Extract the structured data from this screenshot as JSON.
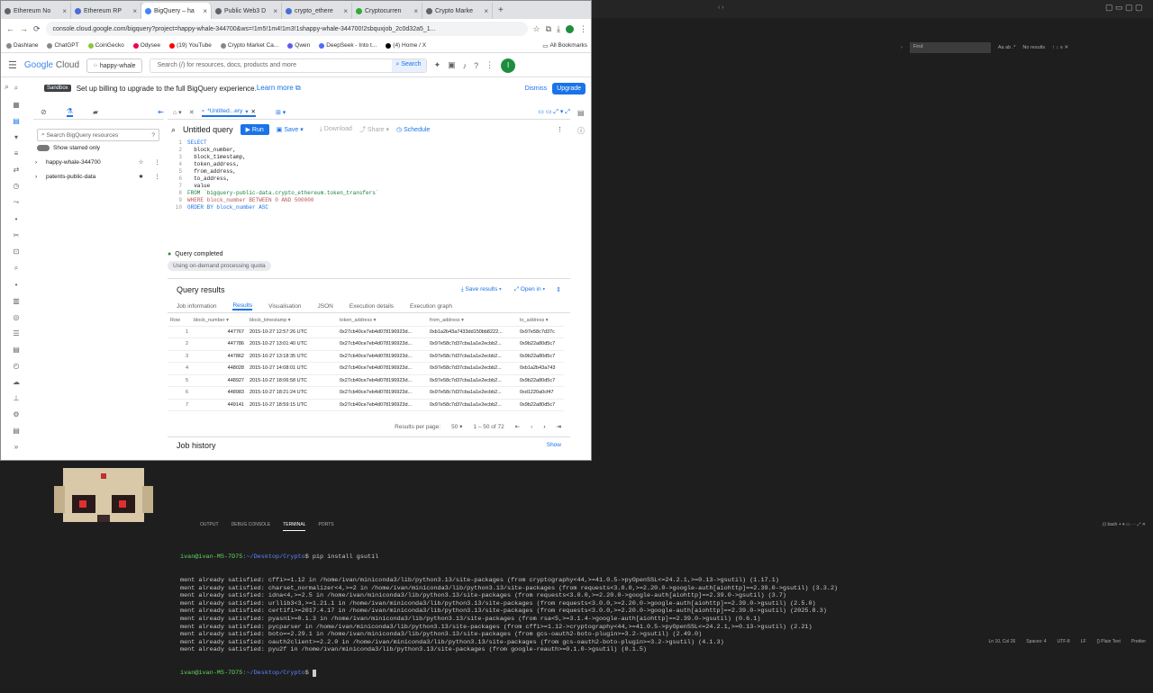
{
  "browser": {
    "tabs": [
      {
        "label": "Ethereum No"
      },
      {
        "label": "Ethereum RP"
      },
      {
        "label": "BigQuery – ha"
      },
      {
        "label": "Public Web3 D"
      },
      {
        "label": "crypto_ethere"
      },
      {
        "label": "Cryptocurren"
      },
      {
        "label": "Crypto Marke"
      }
    ],
    "url": "console.cloud.google.com/bigquery?project=happy-whale-344700&ws=!1m5!1m4!1m3!1shappy-whale-344700!2sbquxjob_2c0d32a5_1...",
    "bookmarks": [
      "Dashlane",
      "ChatGPT",
      "CoinGecko",
      "Odysee",
      "(19) YouTube",
      "Crypto Market Ca...",
      "Qwen",
      "DeepSeek - Into t...",
      "(4) Home / X"
    ],
    "all_bookmarks": "All Bookmarks"
  },
  "gc": {
    "logo_google": "Google",
    "logo_cloud": "Cloud",
    "project": "happy-whale",
    "search_placeholder": "Search (/) for resources, docs, products and more",
    "search_button": "Search",
    "avatar": "I"
  },
  "sandbox": {
    "badge": "Sandbox",
    "text": "Set up billing to upgrade to the full BigQuery experience.",
    "learn_more": "Learn more",
    "dismiss": "Dismiss",
    "upgrade": "Upgrade"
  },
  "explorer": {
    "search_placeholder": "Search BigQuery resources",
    "show_starred": "Show starred only",
    "items": [
      {
        "label": "happy-whale-344700"
      },
      {
        "label": "patents-public-data"
      }
    ]
  },
  "editor": {
    "tab_label": "*Untitled...ery",
    "title": "Untitled query",
    "run": "Run",
    "save": "Save",
    "download": "Download",
    "share": "Share",
    "schedule": "Schedule",
    "status": "Query completed",
    "quota": "Using on-demand processing quota"
  },
  "query_lines": [
    {
      "n": "1",
      "text": "SELECT"
    },
    {
      "n": "2",
      "text": "  block_number,"
    },
    {
      "n": "3",
      "text": "  block_timestamp,"
    },
    {
      "n": "4",
      "text": "  token_address,"
    },
    {
      "n": "5",
      "text": "  from_address,"
    },
    {
      "n": "6",
      "text": "  to_address,"
    },
    {
      "n": "7",
      "text": "  value"
    },
    {
      "n": "8",
      "text": "FROM `bigquery-public-data.crypto_ethereum.token_transfers`"
    },
    {
      "n": "9",
      "text": "WHERE block_number BETWEEN 0 AND 500000"
    },
    {
      "n": "10",
      "text": "ORDER BY block_number ASC"
    }
  ],
  "results": {
    "title": "Query results",
    "save_results": "Save results",
    "open_in": "Open in",
    "tabs": [
      "Job information",
      "Results",
      "Visualisation",
      "JSON",
      "Execution details",
      "Execution graph"
    ],
    "columns": [
      "Row",
      "block_number",
      "block_timestamp",
      "token_address",
      "from_address",
      "to_address"
    ],
    "rows": [
      [
        "1",
        "447767",
        "2015-10-27 12:57:26 UTC",
        "0x27cb40ce7eb4d078196923d...",
        "0xb1a2b43a7433dd150bb8222...",
        "0x97e58c7d37c"
      ],
      [
        "2",
        "447786",
        "2015-10-27 13:01:40 UTC",
        "0x27cb40ce7eb4d078196923d...",
        "0x97e58c7d37cba1a1e2ecbb2...",
        "0x9b22a80d5c7"
      ],
      [
        "3",
        "447862",
        "2015-10-27 13:18:35 UTC",
        "0x27cb40ce7eb4d078196923d...",
        "0x97e58c7d37cba1a1e2ecbb2...",
        "0x9b22a80d5c7"
      ],
      [
        "4",
        "448028",
        "2015-10-27 14:08:01 UTC",
        "0x27cb40ce7eb4d078196923d...",
        "0x97e58c7d37cba1a1e2ecbb2...",
        "0xb1a2b43a743"
      ],
      [
        "5",
        "448927",
        "2015-10-27 18:06:58 UTC",
        "0x27cb40ce7eb4d078196923d...",
        "0x97e58c7d37cba1a1e2ecbb2...",
        "0x9b22a80d5c7"
      ],
      [
        "6",
        "448983",
        "2015-10-27 18:21:24 UTC",
        "0x27cb40ce7eb4d078196923d...",
        "0x97e58c7d37cba1a1e2ecbb2...",
        "0xd1220a0cf47"
      ],
      [
        "7",
        "449141",
        "2015-10-27 18:59:15 UTC",
        "0x27cb40ce7eb4d078196923d...",
        "0x97e58c7d37cba1a1e2ecbb2...",
        "0x9b22a80d5c7"
      ]
    ],
    "per_page_label": "Results per page:",
    "per_page": "50",
    "range": "1 – 50 of 72"
  },
  "job_history": {
    "title": "Job history",
    "show": "Show"
  },
  "terminal": {
    "tabs": [
      "OUTPUT",
      "DEBUG CONSOLE",
      "TERMINAL",
      "PORTS"
    ],
    "prompt1_user": "ivan@ivan-MS-7D75",
    "prompt1_path": ":~/Desktop/Crypto",
    "prompt1_cmd": "$ pip install gsutil",
    "lines": [
      "ment already satisfied: cffi>=1.12 in /home/ivan/miniconda3/lib/python3.13/site-packages (from cryptography<44,>=41.0.5->pyOpenSSL<=24.2.1,>=0.13->gsutil) (1.17.1)",
      "ment already satisfied: charset_normalizer<4,>=2 in /home/ivan/miniconda3/lib/python3.13/site-packages (from requests<3.0.0,>=2.20.0->google-auth[aiohttp]==2.39.0->gsutil) (3.3.2)",
      "ment already satisfied: idna<4,>=2.5 in /home/ivan/miniconda3/lib/python3.13/site-packages (from requests<3.0.0,>=2.20.0->google-auth[aiohttp]==2.39.0->gsutil) (3.7)",
      "ment already satisfied: urllib3<3,>=1.21.1 in /home/ivan/miniconda3/lib/python3.13/site-packages (from requests<3.0.0,>=2.20.0->google-auth[aiohttp]==2.39.0->gsutil) (2.5.0)",
      "ment already satisfied: certifi>=2017.4.17 in /home/ivan/miniconda3/lib/python3.13/site-packages (from requests<3.0.0,>=2.20.0->google-auth[aiohttp]==2.39.0->gsutil) (2025.8.3)",
      "ment already satisfied: pyasn1>=0.1.3 in /home/ivan/miniconda3/lib/python3.13/site-packages (from rsa<5,>=3.1.4->google-auth[aiohttp]==2.39.0->gsutil) (0.6.1)",
      "ment already satisfied: pycparser in /home/ivan/miniconda3/lib/python3.13/site-packages (from cffi>=1.12->cryptography<44,>=41.0.5->pyOpenSSL<=24.2.1,>=0.13->gsutil) (2.21)",
      "ment already satisfied: boto==2.29.1 in /home/ivan/miniconda3/lib/python3.13/site-packages (from gcs-oauth2-boto-plugin>=3.2->gsutil) (2.49.0)",
      "ment already satisfied: oauth2client>=2.2.0 in /home/ivan/miniconda3/lib/python3.13/site-packages (from gcs-oauth2-boto-plugin>=3.2->gsutil) (4.1.3)",
      "ment already satisfied: pyu2f in /home/ivan/miniconda3/lib/python3.13/site-packages (from google-reauth>=0.1.0->gsutil) (0.1.5)"
    ],
    "prompt2_user": "ivan@ivan-MS-7D75",
    "prompt2_path": ":~/Desktop/Crypto",
    "prompt2_cmd": "$ "
  },
  "vscode": {
    "find_placeholder": "Find",
    "find_opts": "Aa  ab  .*",
    "no_results": "No results",
    "terminal_label": "bash",
    "status": [
      "Ln 10, Col 26",
      "Spaces: 4",
      "UTF-8",
      "LF",
      "{} Plain Text",
      "Prettier"
    ]
  },
  "colors": {
    "accent": "#1a73e8",
    "terminal_bg": "#1e1e1e"
  }
}
